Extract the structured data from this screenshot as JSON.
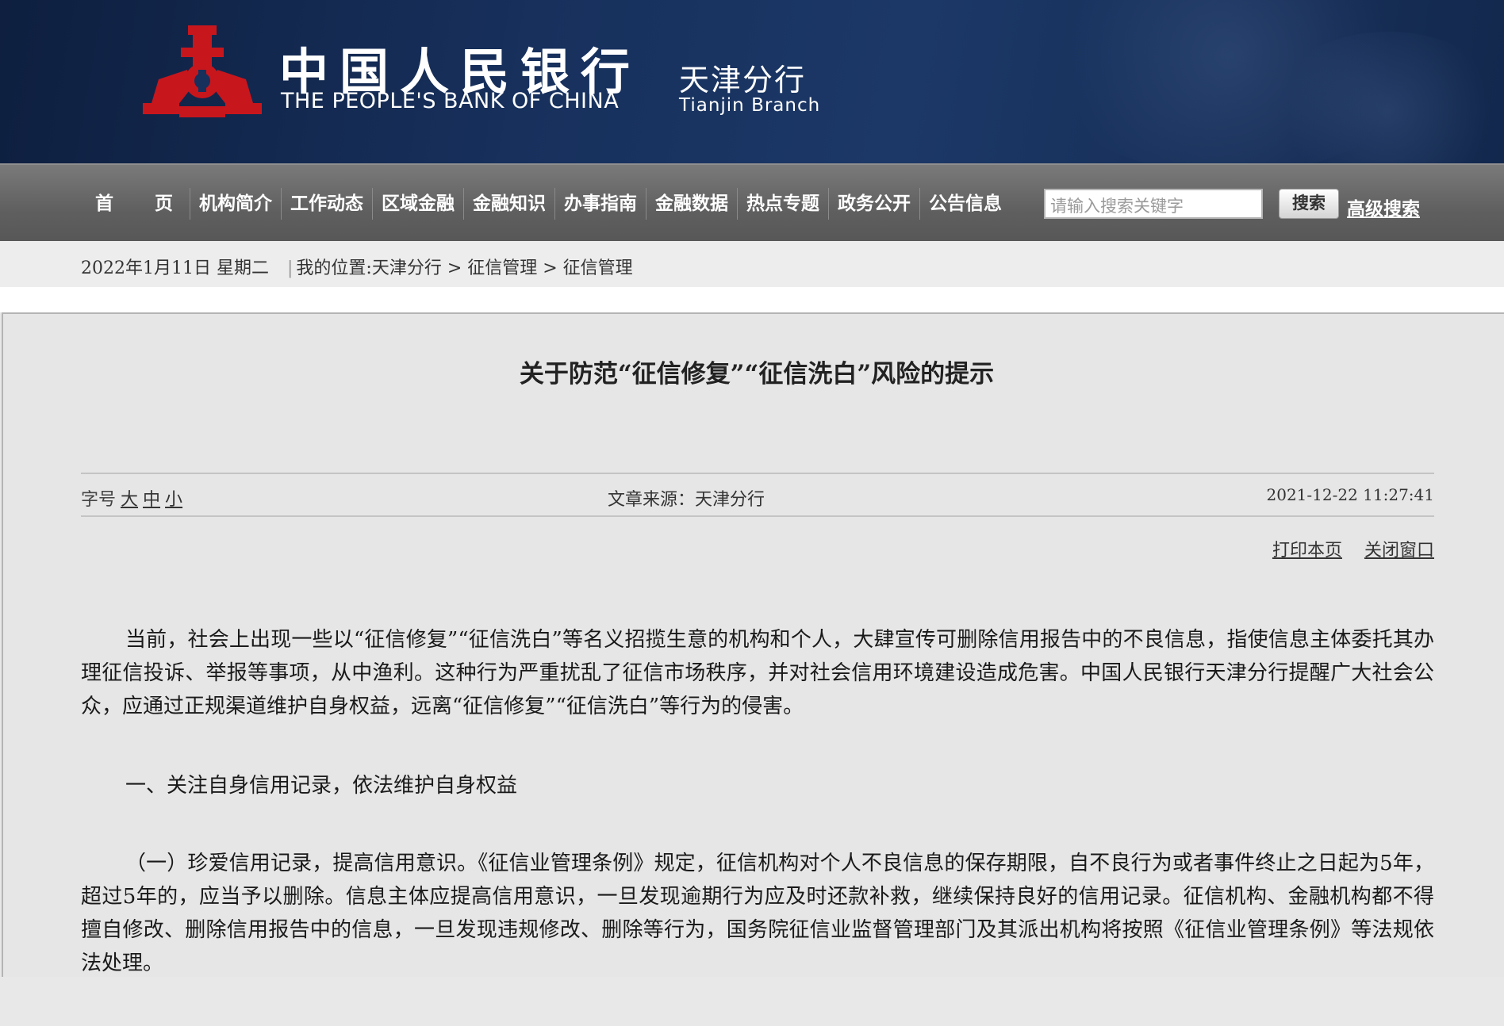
{
  "header": {
    "bank_name_cn": "中国人民银行",
    "bank_name_en": "THE PEOPLE'S BANK OF CHINA",
    "branch_cn": "天津分行",
    "branch_en": "Tianjin  Branch",
    "emblem_color": "#c8161d"
  },
  "nav": {
    "home_first": "首",
    "home_second": "页",
    "items": [
      "机构简介",
      "工作动态",
      "区域金融",
      "金融知识",
      "办事指南",
      "金融数据",
      "热点专题",
      "政务公开",
      "公告信息"
    ],
    "search_placeholder": "请输入搜索关键字",
    "search_button": "搜索",
    "advanced_search": "高级搜索"
  },
  "breadcrumb": {
    "date": "2022年1月11日 星期二",
    "separator": "|",
    "location": "我的位置:天津分行 > 征信管理 > 征信管理"
  },
  "article": {
    "title": "关于防范“征信修复”“征信洗白”风险的提示",
    "font_size_label": "字号",
    "font_large": "大",
    "font_medium": "中",
    "font_small": "小",
    "source": "文章来源：天津分行",
    "publish_time": "2021-12-22 11:27:41",
    "print_link": "打印本页",
    "close_link": "关闭窗口",
    "paragraphs": [
      "当前，社会上出现一些以“征信修复”“征信洗白”等名义招揽生意的机构和个人，大肆宣传可删除信用报告中的不良信息，指使信息主体委托其办理征信投诉、举报等事项，从中渔利。这种行为严重扰乱了征信市场秩序，并对社会信用环境建设造成危害。中国人民银行天津分行提醒广大社会公众，应通过正规渠道维护自身权益，远离“征信修复”“征信洗白”等行为的侵害。",
      "一、关注自身信用记录，依法维护自身权益",
      "（一）珍爱信用记录，提高信用意识。《征信业管理条例》规定，征信机构对个人不良信息的保存期限，自不良行为或者事件终止之日起为5年，超过5年的，应当予以删除。信息主体应提高信用意识，一旦发现逾期行为应及时还款补救，继续保持良好的信用记录。征信机构、金融机构都不得擅自修改、删除信用报告中的信息，一旦发现违规修改、删除等行为，国务院征信业监督管理部门及其派出机构将按照《征信业管理条例》等法规依法处理。"
    ]
  }
}
